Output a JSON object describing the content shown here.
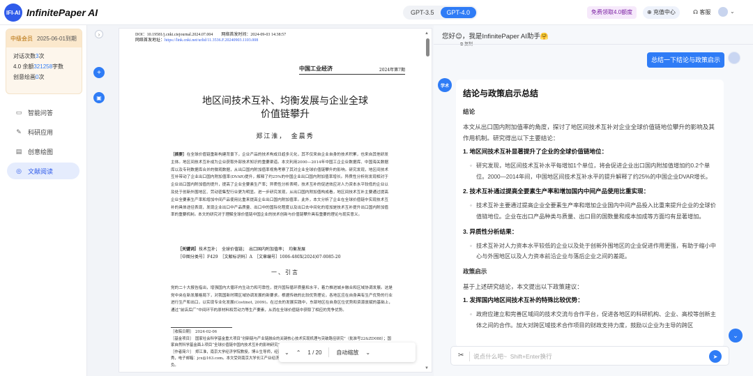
{
  "app": {
    "logo_text": "IFI-AI",
    "brand": "InfinitePaper AI"
  },
  "topbar": {
    "models": [
      "GPT-3.5",
      "GPT-4.0"
    ],
    "active_model": "GPT-4.0",
    "promo": "免费领取4.0额度",
    "recharge": "充值中心",
    "service": "客服",
    "caret": "⌄"
  },
  "sidebar": {
    "member": {
      "badge": "中级会员",
      "expiry": "2025-06-01到期",
      "rows": [
        {
          "label": "对话次数",
          "value": "3",
          "unit": "次"
        },
        {
          "label": "4.0 余额",
          "value": "321258",
          "unit": "字数"
        },
        {
          "label": "创意绘画",
          "value": "0",
          "unit": "次"
        }
      ]
    },
    "nav": [
      {
        "label": "智能问答",
        "icon": "chat-icon"
      },
      {
        "label": "科研应用",
        "icon": "pencil-icon"
      },
      {
        "label": "创意绘图",
        "icon": "document-icon"
      },
      {
        "label": "文献阅读",
        "icon": "compass-icon"
      }
    ],
    "active_nav": "文献阅读"
  },
  "pdf": {
    "doi": "DOI：10.19581/j.cnki.ciejournal.2024.07.004　　网络首发时间：2024-09-03 14:38:57",
    "doi_link_label": "网络首发地址：",
    "doi_link": "https://link.cnki.net/urlid/11.3536.F.20240903.1103.008",
    "journal": "中国工业经济",
    "issue": "2024年第7期",
    "title_line1": "地区间技术互补、均衡发展与企业全球",
    "title_line2": "价值链攀升",
    "authors": "郑江淮，　金晨秀",
    "abstract_label": "［摘要］",
    "abstract": "在全球价值链重新构建背景下，企业产品的技术构成日趋多元化，其不仅来自企业自身的技术积累，也来自其他研发主体。地区间技术互补成为企业获取外部技术知识的重要渠道。本文利用2000—2014年中国工企企业数据库、中国海关数据库以及专利数据库合并的微观数据，从出口国内附加值率视角考察了其对企业全球价值链攀升的影响。研究发现，地区间技术互补带动了企业出口国内附加值率(DVAR)提升，解释了约25%的中国企业出口国内附加值率增长。异质性分析则发现相对于企业出口国内附加值的提升，提高了企业全要素生产率；异质性分析表明，技术互补的促进效应对人力资本水平较低的企业以及处于创新外围地区、劳动密集型行业更为明显。进一步研究发现，从出口国内附加值构成看，地区间技术互补主要通过提高企业全要素生产率和增加中间产品使用比重来提高企业出口国内附加值率。此外，本文分析了企业在全球价值链中实现技术互补的具体途径表现，发现企业出口中产品质量、出口中的国际化程度以及出口去中间化的增加是技术互补提升出口国内附加值率的重要机制。本文的研究对于理解全球价值链中国企业的技术创新与价值链攀升具有重要的理论与现实意义。",
    "keywords_label": "［关键词］",
    "keywords": "技术互补；　全球价值链；　出口国内附加值率；　均衡发展",
    "classification": "［中图分类号］F429　［文献标识码］A　［文章编号］1006-480X(2024)07-0085-20",
    "section1": "一、引言",
    "body": "党的二十大报告指出，增强国内大循环内生动力和可靠性，提升国际循环质量和水平，着力推进城乡融合和区域协调发展。这是党中央在新发展格局下，对我国新时期区域协调发展的新要求。根据传统的比较优势理论，各地区应在自身具有生产优势的行业进行生产和出口，以实现专业化发展(Costinot, 2009)。在过去的发展实践中，东部地区在自身区位优势和资源禀赋的基础上，通过“前店后厂”中间环节的原材料和劳动力等生产要素，从而在全球价值链中获取了相应的竞争优势。",
    "footnote": "［收稿日期］　2024-02-06\n［基金项目］　国家社会科学基金重大项目“创新链与产业链融合的关键核心技术实现机理与突破路径研究”（批准号22&ZD088）；国家自然科学基金面上项目“全球价值链中国内技术互补的影响研究”（批准号23CJL026）。\n［作者简介］　郑江淮，南京大学经济学院教授，博士生导师，经济学博士；金晨秀，南京大学经济学院博士研究生。通讯作者：金晨秀，电子邮箱：jcx@163.com。本文受到南京大学长江产业经济研究院支持，感谢匿名评审专家和编辑部的宝贵意见，当然文责自负。",
    "toolbar": {
      "prev": "⌄",
      "next": "⌃",
      "page": "1 / 20",
      "zoom": "自动缩放",
      "zoom_caret": "⌄"
    }
  },
  "chat": {
    "greeting": "您好😊，我是InfinitePaper AI助手🤗",
    "copy_label": "复制",
    "user_message": "总结一下结论与政策启示",
    "bot_avatar": "学术",
    "answer": {
      "title": "结论与政策启示总结",
      "conclusion_heading": "结论",
      "intro": "本文从出口国内附加值率的角度，探讨了地区间技术互补对企业全球价值链地位攀升的影响及其作用机制。研究得出以下主要结论：",
      "items": [
        {
          "heading": "1. 地区间技术互补显著提升了企业的全球价值链地位：",
          "bullet": "研究发现，地区间技术互补水平每增加1个单位，将会促进企业出口国内附加值增加约0.2个单位。2000—2014年间，中国地区间技术互补水平的提升解释了约25%的中国企业DVAR增长。"
        },
        {
          "heading": "2. 技术互补通过提高全要素生产率和增加国内中间产品使用比重实现：",
          "bullet": "技术互补主要通过提高企业全要素生产率和增加企业国内中间产品投入比重来提升企业的全球价值链地位。企业在出口产品种类与质量、出口目的国数量和成本加成等方面均有显著增加。"
        },
        {
          "heading": "3. 异质性分析结果：",
          "bullet": "技术互补对人力资本水平较低的企业以及处于创新外围地区的企业促进作用更强，有助于缩小中心与外围地区以及人力资本前沿企业与落后企业之间的差距。"
        }
      ],
      "policy_heading": "政策启示",
      "policy_intro": "基于上述研究结论，本文提出以下政策建议：",
      "policy_items": [
        {
          "heading": "1. 发挥国内地区间技术互补的特殊比较优势：",
          "bullet": "政府应建立和完善区域间的技术交流与合作平台，促进各地区的科研机构、企业、高校等创新主体之间的合作。加大对跨区域技术合作项目的财政支持力度，鼓励以企业为主导的跨区"
        }
      ]
    },
    "input_placeholder": "说点什么吧~  Shift+Enter换行"
  }
}
